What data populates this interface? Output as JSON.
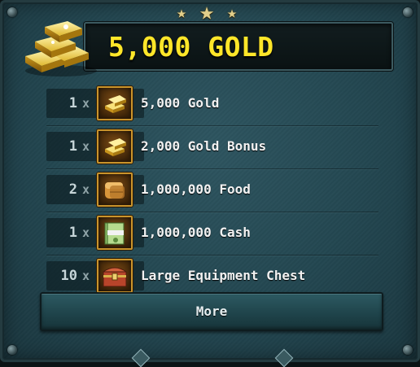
{
  "header": {
    "title": "5,000 GOLD",
    "icon": "gold-bars-icon",
    "stars": 3
  },
  "items": [
    {
      "qty": "1",
      "x": "x",
      "icon": "gold-bars-icon",
      "label": "5,000 Gold"
    },
    {
      "qty": "1",
      "x": "x",
      "icon": "gold-bars-icon",
      "label": "2,000 Gold Bonus"
    },
    {
      "qty": "2",
      "x": "x",
      "icon": "food-bread-icon",
      "label": "1,000,000 Food"
    },
    {
      "qty": "1",
      "x": "x",
      "icon": "cash-stack-icon",
      "label": "1,000,000 Cash"
    },
    {
      "qty": "10",
      "x": "x",
      "icon": "equipment-chest-icon",
      "label": "Large Equipment Chest"
    }
  ],
  "footer": {
    "more_label": "More"
  },
  "colors": {
    "title": "#ffe629",
    "panel": "#234650",
    "icon_border": "#c9942c",
    "button": "#1e4249"
  }
}
